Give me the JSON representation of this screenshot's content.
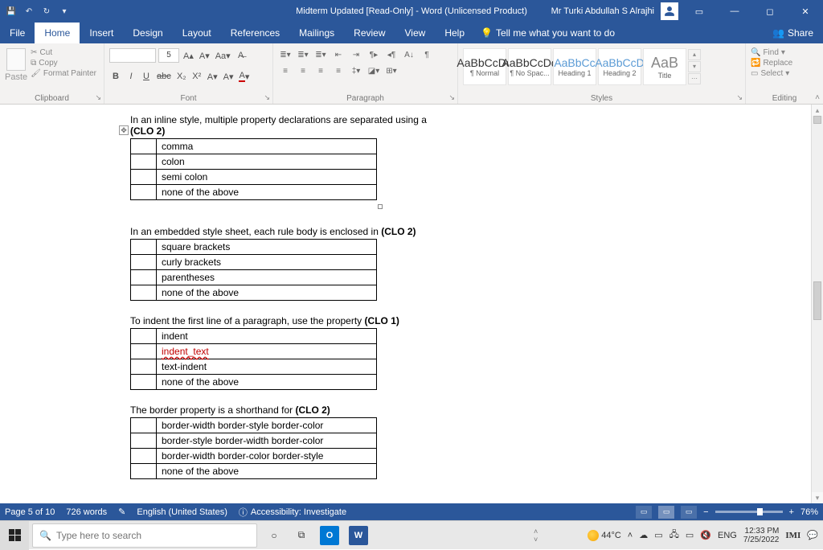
{
  "titlebar": {
    "title": "Midterm Updated [Read-Only] - Word (Unlicensed Product)",
    "user": "Mr Turki Abdullah S Alrajhi"
  },
  "tabs": {
    "file": "File",
    "home": "Home",
    "insert": "Insert",
    "design": "Design",
    "layout": "Layout",
    "references": "References",
    "mailings": "Mailings",
    "review": "Review",
    "view": "View",
    "help": "Help",
    "tell": "Tell me what you want to do",
    "share": "Share"
  },
  "ribbon": {
    "clipboard": {
      "label": "Clipboard",
      "paste": "Paste",
      "cut": "Cut",
      "copy": "Copy",
      "format_painter": "Format Painter"
    },
    "font": {
      "label": "Font",
      "size": "5",
      "bold": "B",
      "italic": "I",
      "underline": "U",
      "strike": "abc",
      "sub": "X₂",
      "sup": "X²"
    },
    "paragraph": {
      "label": "Paragraph"
    },
    "styles": {
      "label": "Styles",
      "items": [
        {
          "sample": "AaBbCcDd",
          "name": "¶ Normal"
        },
        {
          "sample": "AaBbCcDd",
          "name": "¶ No Spac..."
        },
        {
          "sample": "AaBbCc",
          "name": "Heading 1"
        },
        {
          "sample": "AaBbCcD",
          "name": "Heading 2"
        },
        {
          "sample": "AaB",
          "name": "Title"
        }
      ]
    },
    "editing": {
      "label": "Editing",
      "find": "Find",
      "replace": "Replace",
      "select": "Select"
    }
  },
  "doc": {
    "q1": {
      "text": "In an inline style, multiple property declarations are separated using a",
      "clo": "(CLO 2)",
      "opts": [
        "comma",
        "colon",
        "semi colon",
        "none of the above"
      ]
    },
    "q2": {
      "text": "In an embedded style sheet, each rule body is enclosed in",
      "clo": "(CLO 2)",
      "opts": [
        "square brackets",
        "curly brackets",
        "parentheses",
        "none of the above"
      ]
    },
    "q3": {
      "text": "To indent the first line of a paragraph, use the property",
      "clo": "(CLO 1)",
      "opts": [
        "indent",
        "indent_text",
        "text-indent",
        "none of the above"
      ]
    },
    "q4": {
      "text": "The border property is a shorthand for",
      "clo": "(CLO 2)",
      "opts": [
        "border-width border-style border-color",
        "border-style border-width border-color",
        "border-width border-color border-style",
        "none of the above"
      ]
    }
  },
  "status": {
    "page": "Page 5 of 10",
    "words": "726 words",
    "lang": "English (United States)",
    "a11y": "Accessibility: Investigate",
    "zoom": "76%"
  },
  "taskbar": {
    "search_placeholder": "Type here to search",
    "weather": "44°C",
    "lang": "ENG",
    "time": "12:33 PM",
    "date": "7/25/2022"
  }
}
